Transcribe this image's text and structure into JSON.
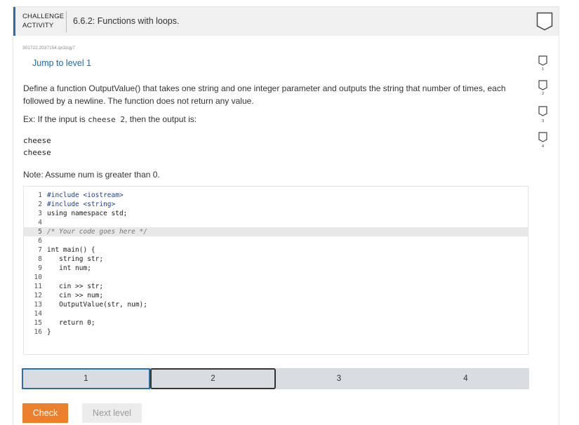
{
  "header": {
    "label_line1": "CHALLENGE",
    "label_line2": "ACTIVITY",
    "title": "6.6.2: Functions with loops."
  },
  "id_code": "301722.2037154.qx3zqy7",
  "jump_link": "Jump to level 1",
  "description": "Define a function OutputValue() that takes one string and one integer parameter and outputs the string that number of times, each followed by a newline. The function does not return any value.",
  "example": {
    "prefix": "Ex: If the input is",
    "input_code": "cheese 2",
    "suffix": ", then the output is:"
  },
  "output_lines": [
    "cheese",
    "cheese"
  ],
  "note": "Note: Assume num is greater than 0.",
  "code_lines": [
    {
      "n": "1",
      "text": "#include <iostream>"
    },
    {
      "n": "2",
      "text": "#include <string>"
    },
    {
      "n": "3",
      "text": "using namespace std;"
    },
    {
      "n": "4",
      "text": ""
    },
    {
      "n": "5",
      "text": "/* Your code goes here */"
    },
    {
      "n": "6",
      "text": ""
    },
    {
      "n": "7",
      "text": "int main() {"
    },
    {
      "n": "8",
      "text": "   string str;"
    },
    {
      "n": "9",
      "text": "   int num;"
    },
    {
      "n": "10",
      "text": ""
    },
    {
      "n": "11",
      "text": "   cin >> str;"
    },
    {
      "n": "12",
      "text": "   cin >> num;"
    },
    {
      "n": "13",
      "text": "   OutputValue(str, num);"
    },
    {
      "n": "14",
      "text": ""
    },
    {
      "n": "15",
      "text": "   return 0;"
    },
    {
      "n": "16",
      "text": "}"
    }
  ],
  "levels": [
    "1",
    "2",
    "3",
    "4"
  ],
  "buttons": {
    "check": "Check",
    "next_level": "Next level"
  },
  "sidebar_badges": [
    "1",
    "2",
    "3",
    "4"
  ],
  "colors": {
    "accent_blue": "#2d6da8",
    "check_orange": "#ec7f2c",
    "level_bar": "#d8dde1"
  }
}
